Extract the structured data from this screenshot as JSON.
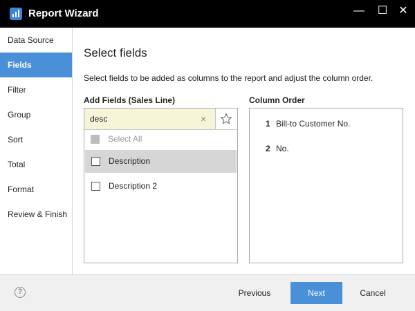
{
  "window": {
    "title": "Report Wizard",
    "icon": "report-chart-icon",
    "controls": {
      "minimize": "—",
      "maximize": "☐",
      "close": "✕"
    }
  },
  "sidebar": {
    "items": [
      {
        "label": "Data Source",
        "active": false
      },
      {
        "label": "Fields",
        "active": true
      },
      {
        "label": "Filter",
        "active": false
      },
      {
        "label": "Group",
        "active": false
      },
      {
        "label": "Sort",
        "active": false
      },
      {
        "label": "Total",
        "active": false
      },
      {
        "label": "Format",
        "active": false
      },
      {
        "label": "Review & Finish",
        "active": false
      }
    ]
  },
  "main": {
    "heading": "Select fields",
    "description": "Select fields to be added as columns to the report and adjust the column order.",
    "add_fields": {
      "label": "Add Fields (Sales Line)",
      "search_value": "desc",
      "clear_icon": "×",
      "select_all_label": "Select All",
      "items": [
        {
          "label": "Description",
          "checked": false,
          "highlighted": true
        },
        {
          "label": "Description 2",
          "checked": false,
          "highlighted": false
        }
      ]
    },
    "column_order": {
      "label": "Column Order",
      "items": [
        {
          "num": "1",
          "name": "Bill-to Customer No."
        },
        {
          "num": "2",
          "name": "No."
        }
      ]
    }
  },
  "footer": {
    "help_icon": "?",
    "previous_label": "Previous",
    "next_label": "Next",
    "cancel_label": "Cancel"
  },
  "colors": {
    "accent": "#4a90d9",
    "titlebar": "#000000",
    "search_bg": "#f7f5d8",
    "row_highlight": "#d6d6d6",
    "footer_bg": "#f0f0f0"
  }
}
